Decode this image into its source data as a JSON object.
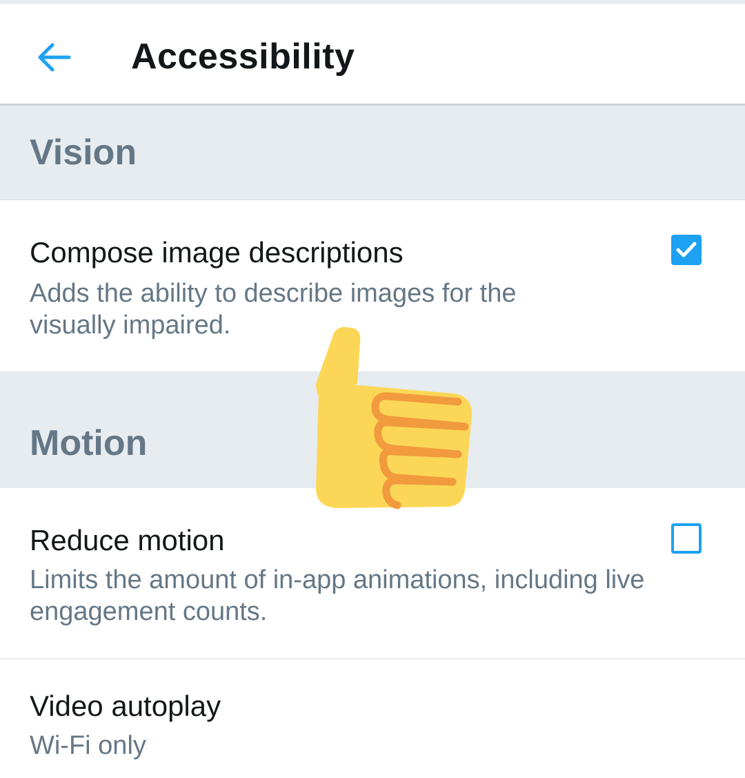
{
  "header": {
    "title": "Accessibility",
    "back_icon": "arrow-left-icon",
    "accent_color": "#1da1f2"
  },
  "sections": {
    "vision": {
      "title": "Vision",
      "items": {
        "compose": {
          "title": "Compose image descriptions",
          "description": "Adds the ability to describe images for the visually impaired.",
          "checked": true
        }
      }
    },
    "motion": {
      "title": "Motion",
      "items": {
        "reduce": {
          "title": "Reduce motion",
          "description": "Limits the amount of in-app animations, including live engagement counts.",
          "checked": false
        },
        "video": {
          "title": "Video autoplay",
          "value": "Wi-Fi only"
        }
      }
    }
  },
  "overlay": {
    "sticker_icon": "thumbs-up-icon"
  }
}
